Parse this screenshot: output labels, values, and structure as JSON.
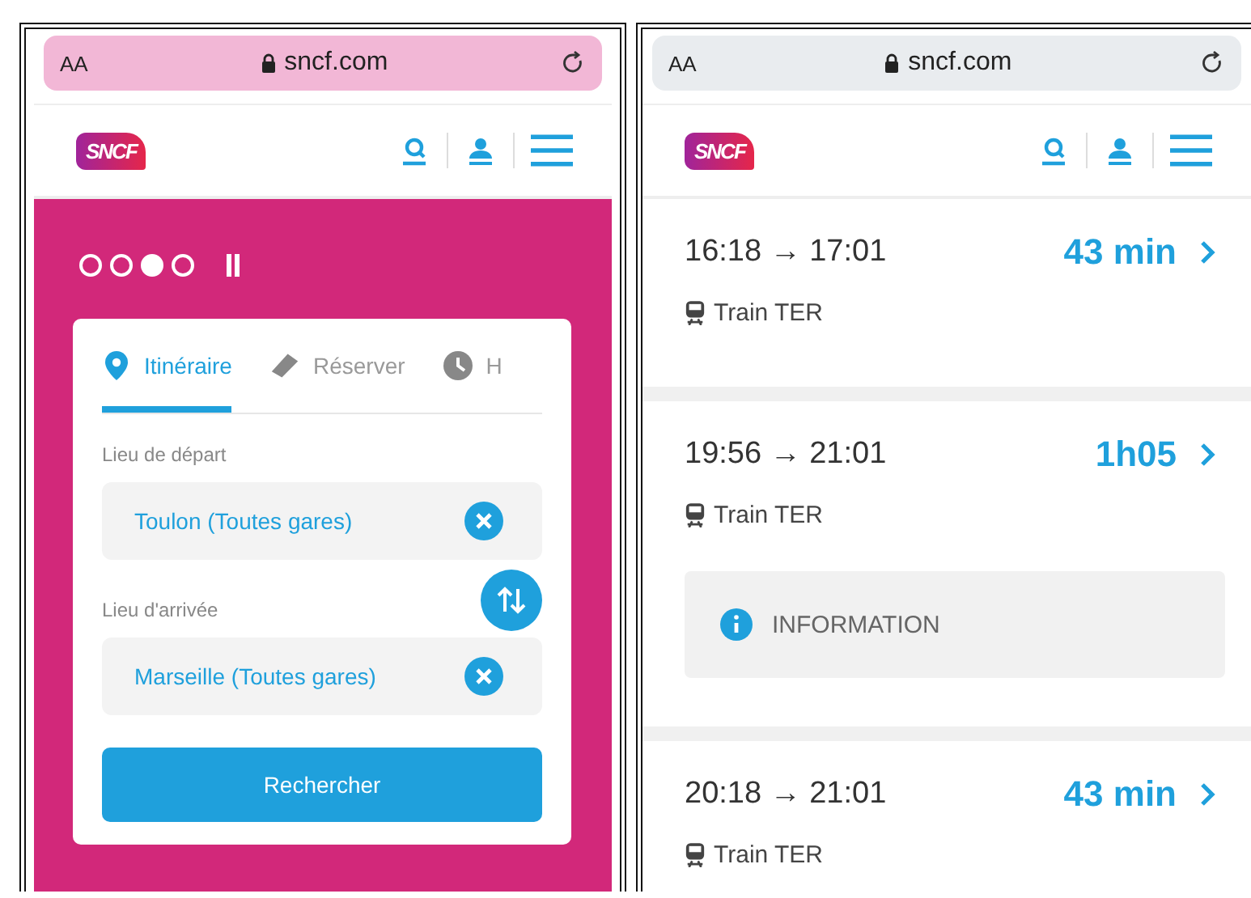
{
  "left_phone": {
    "browser": {
      "text_size": "AA",
      "url": "sncf.com"
    },
    "logo": "SNCF",
    "carousel_dots": [
      {
        "selected": false
      },
      {
        "selected": false
      },
      {
        "selected": true
      },
      {
        "selected": false
      }
    ],
    "tabs": [
      {
        "kind": "pin",
        "label": "Itinéraire",
        "selected": true
      },
      {
        "kind": "ticket",
        "label": "Réserver",
        "selected": false
      },
      {
        "kind": "clock",
        "label": "H",
        "selected": false
      }
    ],
    "departure": {
      "label": "Lieu de départ",
      "value": "Toulon (Toutes gares)"
    },
    "arrival": {
      "label": "Lieu d'arrivée",
      "value": "Marseille (Toutes gares)"
    },
    "search_button": "Rechercher"
  },
  "right_phone": {
    "browser": {
      "text_size": "AA",
      "url": "sncf.com"
    },
    "logo": "SNCF",
    "items": [
      {
        "kind": "journey",
        "times": "16:18 → 17:01",
        "duration": "43 min",
        "mode": "Train TER"
      },
      {
        "kind": "journey",
        "times": "19:56 → 21:01",
        "duration": "1h05",
        "mode": "Train TER",
        "notice": "INFORMATION"
      },
      {
        "kind": "journey",
        "times": "20:18 → 21:01",
        "duration": "43 min",
        "mode": "Train TER"
      }
    ]
  }
}
